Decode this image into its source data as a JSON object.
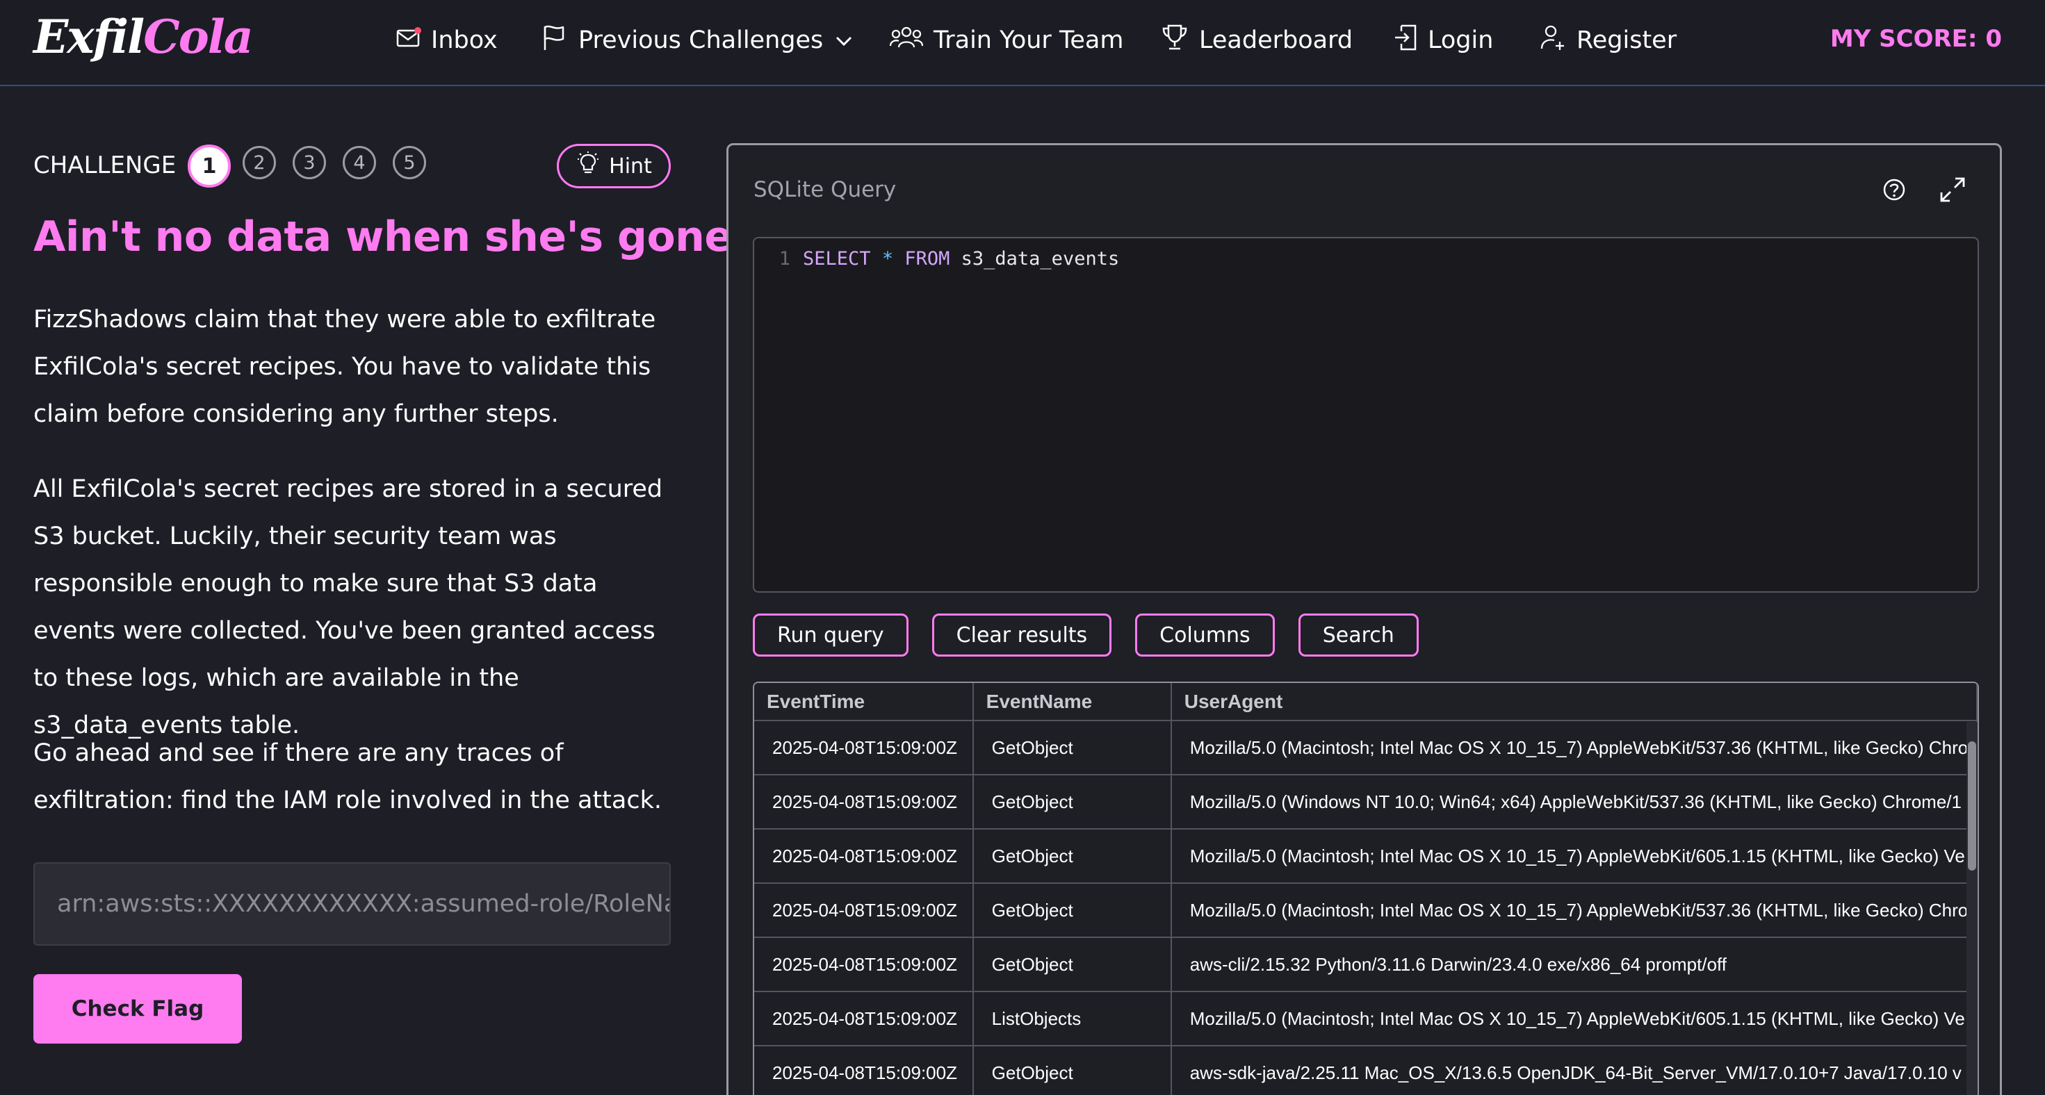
{
  "nav": {
    "logo_part1": "Exfil",
    "logo_part2": "Cola",
    "inbox": "Inbox",
    "previous_challenges": "Previous Challenges",
    "train_team": "Train Your Team",
    "leaderboard": "Leaderboard",
    "login": "Login",
    "register": "Register",
    "score": "MY SCORE: 0"
  },
  "challenge": {
    "label": "CHALLENGE",
    "steps": [
      "1",
      "2",
      "3",
      "4",
      "5"
    ],
    "active_step": "1",
    "hint": "Hint",
    "title": "Ain't no data when she's gone",
    "para1": "FizzShadows claim that they were able to exfiltrate ExfilCola's secret recipes. You have to validate this claim before considering any further steps.",
    "para2": "All ExfilCola's secret recipes are stored in a secured S3 bucket. Luckily, their security team was responsible enough to make sure that S3 data events were collected. You've been granted access to these logs, which are available in the s3_data_events table.",
    "para3": "Go ahead and see if there are any traces of exfiltration: find the IAM role involved in the attack.",
    "flag_placeholder": "arn:aws:sts::XXXXXXXXXXXX:assumed-role/RoleName",
    "check_flag": "Check Flag"
  },
  "query": {
    "panel_title": "SQLite Query",
    "line_number": "1",
    "code_select": "SELECT",
    "code_star": "*",
    "code_from": "FROM",
    "code_table": "s3_data_events",
    "buttons": {
      "run": "Run query",
      "clear": "Clear results",
      "columns": "Columns",
      "search": "Search"
    }
  },
  "results": {
    "columns": [
      "EventTime",
      "EventName",
      "UserAgent"
    ],
    "rows": [
      [
        "2025-04-08T15:09:00Z",
        "GetObject",
        "Mozilla/5.0 (Macintosh; Intel Mac OS X 10_15_7) AppleWebKit/537.36 (KHTML, like Gecko) Chro"
      ],
      [
        "2025-04-08T15:09:00Z",
        "GetObject",
        "Mozilla/5.0 (Windows NT 10.0; Win64; x64) AppleWebKit/537.36 (KHTML, like Gecko) Chrome/1"
      ],
      [
        "2025-04-08T15:09:00Z",
        "GetObject",
        "Mozilla/5.0 (Macintosh; Intel Mac OS X 10_15_7) AppleWebKit/605.1.15 (KHTML, like Gecko) Ve"
      ],
      [
        "2025-04-08T15:09:00Z",
        "GetObject",
        "Mozilla/5.0 (Macintosh; Intel Mac OS X 10_15_7) AppleWebKit/537.36 (KHTML, like Gecko) Chro"
      ],
      [
        "2025-04-08T15:09:00Z",
        "GetObject",
        "aws-cli/2.15.32 Python/3.11.6 Darwin/23.4.0 exe/x86_64 prompt/off"
      ],
      [
        "2025-04-08T15:09:00Z",
        "ListObjects",
        "Mozilla/5.0 (Macintosh; Intel Mac OS X 10_15_7) AppleWebKit/605.1.15 (KHTML, like Gecko) Ve"
      ],
      [
        "2025-04-08T15:09:00Z",
        "GetObject",
        "aws-sdk-java/2.25.11 Mac_OS_X/13.6.5 OpenJDK_64-Bit_Server_VM/17.0.10+7 Java/17.0.10 v"
      ]
    ]
  },
  "colors": {
    "accent": "#ff7bf0",
    "background": "#1e1e27",
    "nav_border": "#2c4f8a"
  },
  "icons": {
    "inbox": "envelope-icon",
    "previous_challenges": "flag-icon",
    "train_team": "team-icon",
    "leaderboard": "trophy-icon",
    "login": "login-icon",
    "register": "user-plus-icon",
    "hint": "lightbulb-icon",
    "help": "question-circle-icon",
    "expand": "expand-icon"
  }
}
